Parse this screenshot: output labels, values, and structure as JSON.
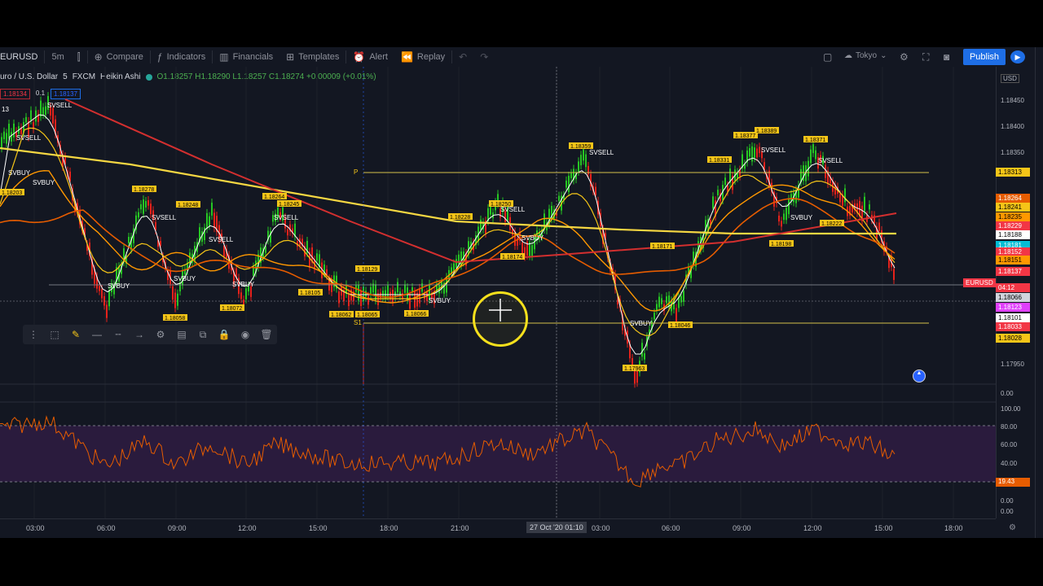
{
  "toolbar": {
    "symbol": "EURUSD",
    "interval": "5m",
    "compare": "Compare",
    "indicators": "Indicators",
    "financials": "Financials",
    "templates": "Templates",
    "alert": "Alert",
    "replay": "Replay",
    "timezone": "Tokyo",
    "publish": "Publish"
  },
  "legend": {
    "title": "uro / U.S. Dollar",
    "interval": "5",
    "exchange": "FXCM",
    "chart_style": "Heikin Ashi",
    "ohlc": "O1.18257 H1.18290 L1.18257 C1.18274 +0.00009 (+0.01%)"
  },
  "indicator_row": {
    "bid": "1.18134",
    "spread": "0.1",
    "ask": "1.18137"
  },
  "side_count": "13",
  "price_axis": {
    "currency": "USD",
    "ticks": [
      "1.18450",
      "1.18400",
      "1.18350",
      "1.17950",
      "0.00"
    ],
    "labels": [
      {
        "text": "1.18313",
        "color": "#f5c518",
        "text_color": "#000"
      },
      {
        "text": "1.18264",
        "color": "#e65c00",
        "text_color": "#fff"
      },
      {
        "text": "1.18241",
        "color": "#f5c518",
        "text_color": "#000"
      },
      {
        "text": "1.18235",
        "color": "#ff9800",
        "text_color": "#000"
      },
      {
        "text": "1.18229",
        "color": "#f23645",
        "text_color": "#fff"
      },
      {
        "text": "1.18188",
        "color": "#ffffff",
        "text_color": "#000"
      },
      {
        "text": "1.18181",
        "color": "#00bcd4",
        "text_color": "#fff"
      },
      {
        "text": "1.18152",
        "color": "#f23645",
        "text_color": "#fff"
      },
      {
        "text": "1.18151",
        "color": "#ff9800",
        "text_color": "#000"
      },
      {
        "text": "1.18137",
        "color": "#f23645",
        "text_color": "#fff"
      },
      {
        "text": "04:12",
        "color": "#f23645",
        "text_color": "#fff"
      },
      {
        "text": "1.18066",
        "color": "#d1d4dc",
        "text_color": "#000"
      },
      {
        "text": "1.18123",
        "color": "#e040fb",
        "text_color": "#fff"
      },
      {
        "text": "1.18101",
        "color": "#ffffff",
        "text_color": "#000"
      },
      {
        "text": "1.18033",
        "color": "#f23645",
        "text_color": "#fff"
      },
      {
        "text": "1.18028",
        "color": "#f5c518",
        "text_color": "#000"
      }
    ],
    "eurusd_tag": "EURUSD",
    "rsi_ticks": [
      "100.00",
      "80.00",
      "60.00",
      "40.00",
      "0.00"
    ],
    "rsi_value": "19.43"
  },
  "time_axis": {
    "ticks": [
      "03:00",
      "06:00",
      "09:00",
      "12:00",
      "15:00",
      "18:00",
      "21:00",
      "03:00",
      "06:00",
      "09:00",
      "12:00",
      "15:00",
      "18:00"
    ],
    "crosshair": "27 Oct '20   01:10"
  },
  "signals": {
    "sell": "SVSELL",
    "buy": "SVBUY",
    "pivot_p": "P",
    "pivot_s1": "S1"
  },
  "price_tags": [
    "1.18278",
    "1.18248",
    "1.18264",
    "1.18129",
    "1.18105",
    "1.18072",
    "1.18058",
    "1.18062",
    "1.18065",
    "1.18066",
    "1.18228",
    "1.18250",
    "1.18174",
    "1.18359",
    "1.18171",
    "1.18046",
    "1.17963",
    "1.18331",
    "1.18377",
    "1.18389",
    "1.18371",
    "1.18198",
    "1.18222",
    "1.18203",
    "1.18245"
  ],
  "drawing_tools": [
    "drag-handle",
    "select",
    "pen",
    "line-style",
    "line-width",
    "line-end",
    "settings",
    "fill",
    "copy",
    "lock",
    "visibility",
    "delete"
  ],
  "colors": {
    "background": "#131722",
    "bull": "#26c623",
    "bear": "#e5221b",
    "rsi_band": "#2a1b3d",
    "accent": "#1e6ee6"
  }
}
